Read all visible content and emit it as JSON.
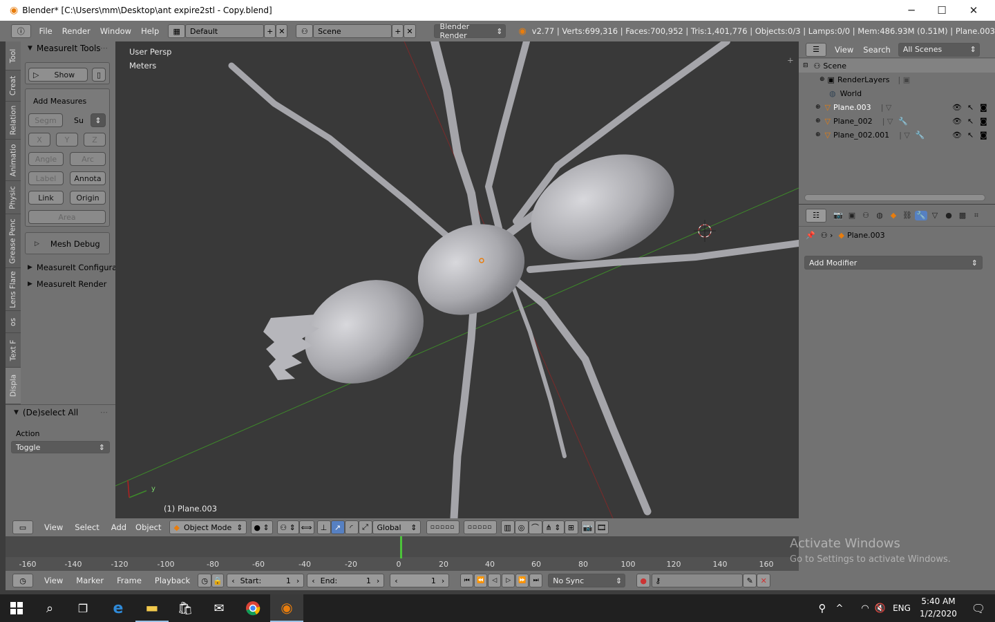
{
  "window": {
    "title": "Blender* [C:\\Users\\mm\\Desktop\\ant expire2stl - Copy.blend]",
    "minimize": "─",
    "maximize": "☐",
    "close": "✕"
  },
  "info_header": {
    "menus": [
      "File",
      "Render",
      "Window",
      "Help"
    ],
    "layout": "Default",
    "scene": "Scene",
    "engine": "Blender Render",
    "stats": "v2.77 | Verts:699,316 | Faces:700,952 | Tris:1,401,776 | Objects:0/3 | Lamps:0/0 | Mem:486.93M (0.51M) | Plane.003"
  },
  "tool_tabs": [
    "Tool",
    "Creat",
    "Relation",
    "Animatio",
    "Physic",
    "Grease Penc",
    "Lens Flare",
    "os",
    "Text F",
    "Displa"
  ],
  "measureit": {
    "title": "MeasureIt Tools",
    "show": "Show",
    "add_measures": "Add Measures",
    "segment": "Segm",
    "su": "Su",
    "x": "X",
    "y": "Y",
    "z": "Z",
    "angle": "Angle",
    "arc": "Arc",
    "label": "Label",
    "annotation": "Annota",
    "link": "Link",
    "origin": "Origin",
    "area": "Area",
    "mesh_debug": "Mesh Debug",
    "configuration": "MeasureIt Configura",
    "render": "MeasureIt Render"
  },
  "operator": {
    "title": "(De)select All",
    "action_label": "Action",
    "action_value": "Toggle"
  },
  "viewport": {
    "view_name": "User Persp",
    "units": "Meters",
    "object_label": "(1) Plane.003",
    "axis_y": "y"
  },
  "outliner": {
    "view": "View",
    "search": "Search",
    "filter": "All Scenes",
    "items": [
      {
        "name": "Scene"
      },
      {
        "name": "RenderLayers"
      },
      {
        "name": "World"
      },
      {
        "name": "Plane.003"
      },
      {
        "name": "Plane_002"
      },
      {
        "name": "Plane_002.001"
      }
    ]
  },
  "properties": {
    "object_path": "Plane.003",
    "add_modifier": "Add Modifier"
  },
  "view3d_header": {
    "menus": [
      "View",
      "Select",
      "Add",
      "Object"
    ],
    "mode": "Object Mode",
    "orientation": "Global"
  },
  "timeline": {
    "ruler": [
      "-160",
      "-140",
      "-120",
      "-100",
      "-80",
      "-60",
      "-40",
      "-20",
      "0",
      "20",
      "40",
      "60",
      "80",
      "100",
      "120",
      "140",
      "160"
    ],
    "menus": [
      "View",
      "Marker",
      "Frame",
      "Playback"
    ],
    "start_label": "Start:",
    "start_value": "1",
    "end_label": "End:",
    "end_value": "1",
    "current": "1",
    "sync": "No Sync"
  },
  "activation": {
    "line1": "Activate Windows",
    "line2": "Go to Settings to activate Windows."
  },
  "taskbar": {
    "lang": "ENG",
    "time": "5:40 AM",
    "date": "1/2/2020"
  },
  "colors": {
    "accent_blue": "#5680c2",
    "header_gray": "#727272",
    "viewport_bg": "#393939",
    "x_axis": "#8b2a2a",
    "y_axis": "#3e8a2a",
    "playhead": "#4cc33a"
  }
}
